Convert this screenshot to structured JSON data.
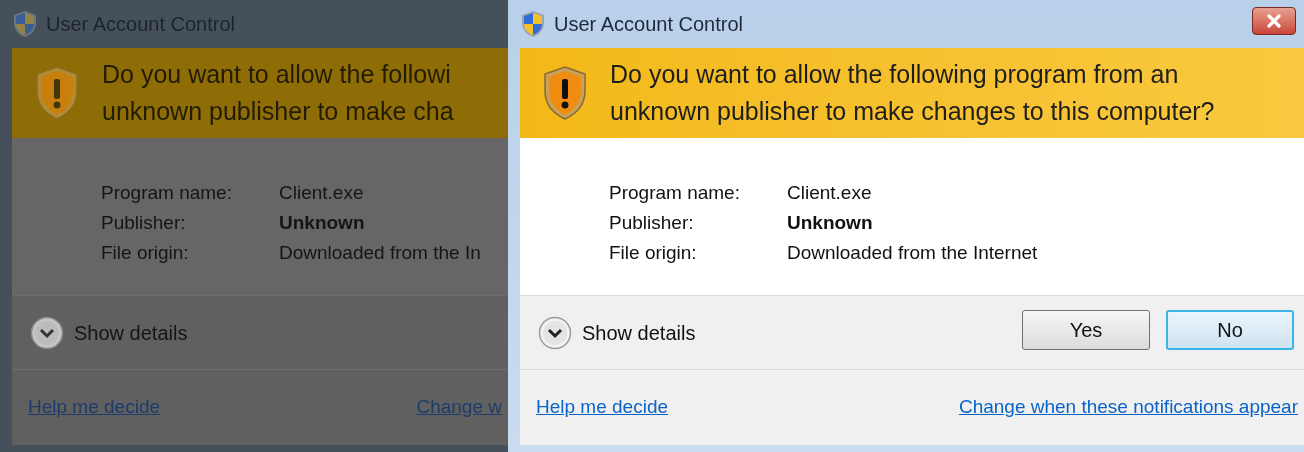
{
  "dialogs": [
    {
      "dimmed": true,
      "title": "User Account Control",
      "question_lines": [
        "Do you want to allow the followi",
        "unknown publisher to make cha"
      ],
      "fields": [
        {
          "label": "Program name:",
          "value": "Client.exe",
          "bold": false
        },
        {
          "label": "Publisher:",
          "value": "Unknown",
          "bold": true
        },
        {
          "label": "File origin:",
          "value": "Downloaded from the In",
          "bold": false
        }
      ],
      "details": "Show details",
      "help_link": "Help me decide",
      "settings_link": "Change w"
    },
    {
      "dimmed": false,
      "title": "User Account Control",
      "close": true,
      "question_lines": [
        "Do you want to allow the following program from an",
        "unknown publisher to make changes to this computer?"
      ],
      "fields": [
        {
          "label": "Program name:",
          "value": "Client.exe",
          "bold": false
        },
        {
          "label": "Publisher:",
          "value": "Unknown",
          "bold": true
        },
        {
          "label": "File origin:",
          "value": "Downloaded from the Internet",
          "bold": false
        }
      ],
      "details": "Show details",
      "buttons": [
        {
          "label": "Yes",
          "default": false
        },
        {
          "label": "No",
          "default": true
        }
      ],
      "help_link": "Help me decide",
      "settings_link": "Change when these notifications appear"
    }
  ]
}
